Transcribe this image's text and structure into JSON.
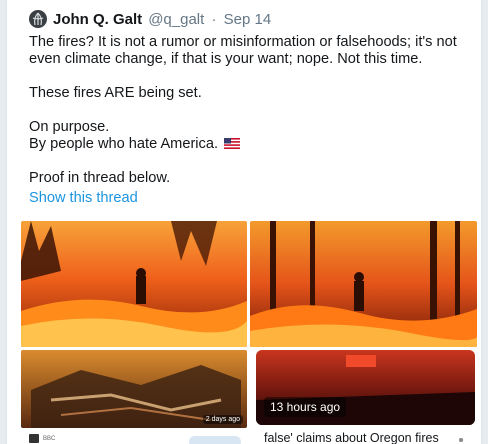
{
  "tweet": {
    "name": "John Q. Galt",
    "handle": "@q_galt",
    "separator": "·",
    "date": "Sep 14",
    "lines": [
      "The fires? It is not a rumor or misinformation or falsehoods; it's not even climate change, if that is your want; nope. Not this time.",
      "These fires ARE being set.",
      "On purpose.",
      "By people who hate America."
    ],
    "flag_icon": "us-flag-icon",
    "proof_line": "Proof in thread below.",
    "show_thread": "Show this thread"
  },
  "media": {
    "items": [
      {
        "kind": "image",
        "subject": "firefighter-in-forest-fire"
      },
      {
        "kind": "image",
        "subject": "firefighter-in-burning-woods"
      },
      {
        "kind": "image",
        "subject": "burned-house-ruins",
        "duration": "2 days ago"
      },
      {
        "kind": "video",
        "subject": "street-with-fire-glow",
        "duration": "13 hours ago"
      }
    ],
    "source_label": "BBC",
    "card_caption": "false' claims about Oregon fires"
  },
  "colors": {
    "link": "#1b95e0",
    "text": "#14171a",
    "secondary": "#657786",
    "fire": "#f26a1b"
  }
}
